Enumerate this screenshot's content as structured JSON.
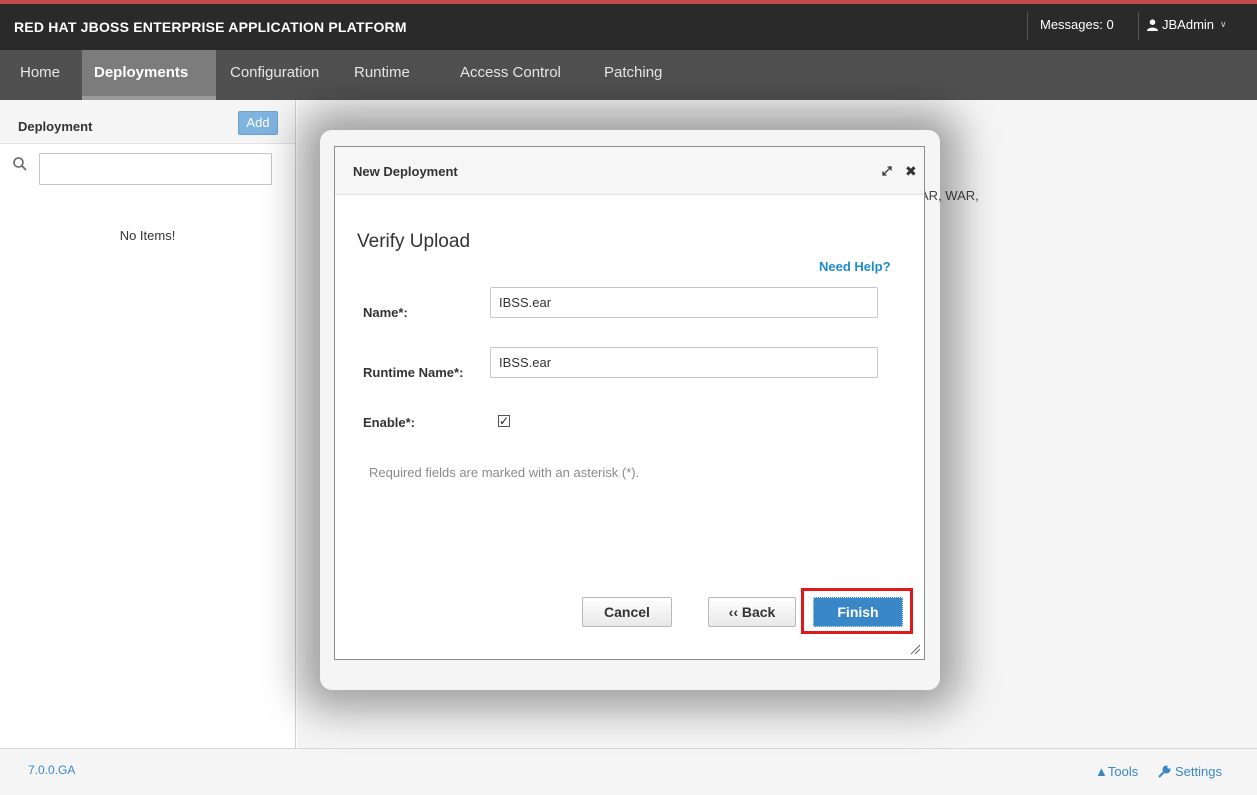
{
  "header": {
    "brand": "RED HAT JBOSS ENTERPRISE APPLICATION PLATFORM",
    "messages": "Messages: 0",
    "user": "JBAdmin"
  },
  "nav": {
    "items": [
      {
        "label": "Home"
      },
      {
        "label": "Deployments"
      },
      {
        "label": "Configuration"
      },
      {
        "label": "Runtime"
      },
      {
        "label": "Access Control"
      },
      {
        "label": "Patching"
      }
    ],
    "active": "Deployments"
  },
  "sidebar": {
    "title": "Deployment",
    "add_label": "Add",
    "search_value": "",
    "empty_text": "No Items!"
  },
  "main": {
    "background_text": "AR, WAR,"
  },
  "modal": {
    "title": "New Deployment",
    "heading": "Verify Upload",
    "help_link": "Need Help?",
    "fields": {
      "name_label": "Name*:",
      "name_value": "IBSS.ear",
      "runtime_label": "Runtime Name*:",
      "runtime_value": "IBSS.ear",
      "enable_label": "Enable*:",
      "enable_checked": true
    },
    "required_note": "Required fields are marked with an asterisk (*).",
    "buttons": {
      "cancel": "Cancel",
      "back": "‹‹ Back",
      "finish": "Finish"
    }
  },
  "footer": {
    "version": "7.0.0.GA",
    "tools": "▲Tools",
    "settings": "Settings"
  },
  "colors": {
    "header_bg": "#2a2a2a",
    "nav_bg": "#505050",
    "accent_red": "#c44b4b",
    "link_blue": "#3a87c8",
    "highlight_red": "#e0191b"
  }
}
